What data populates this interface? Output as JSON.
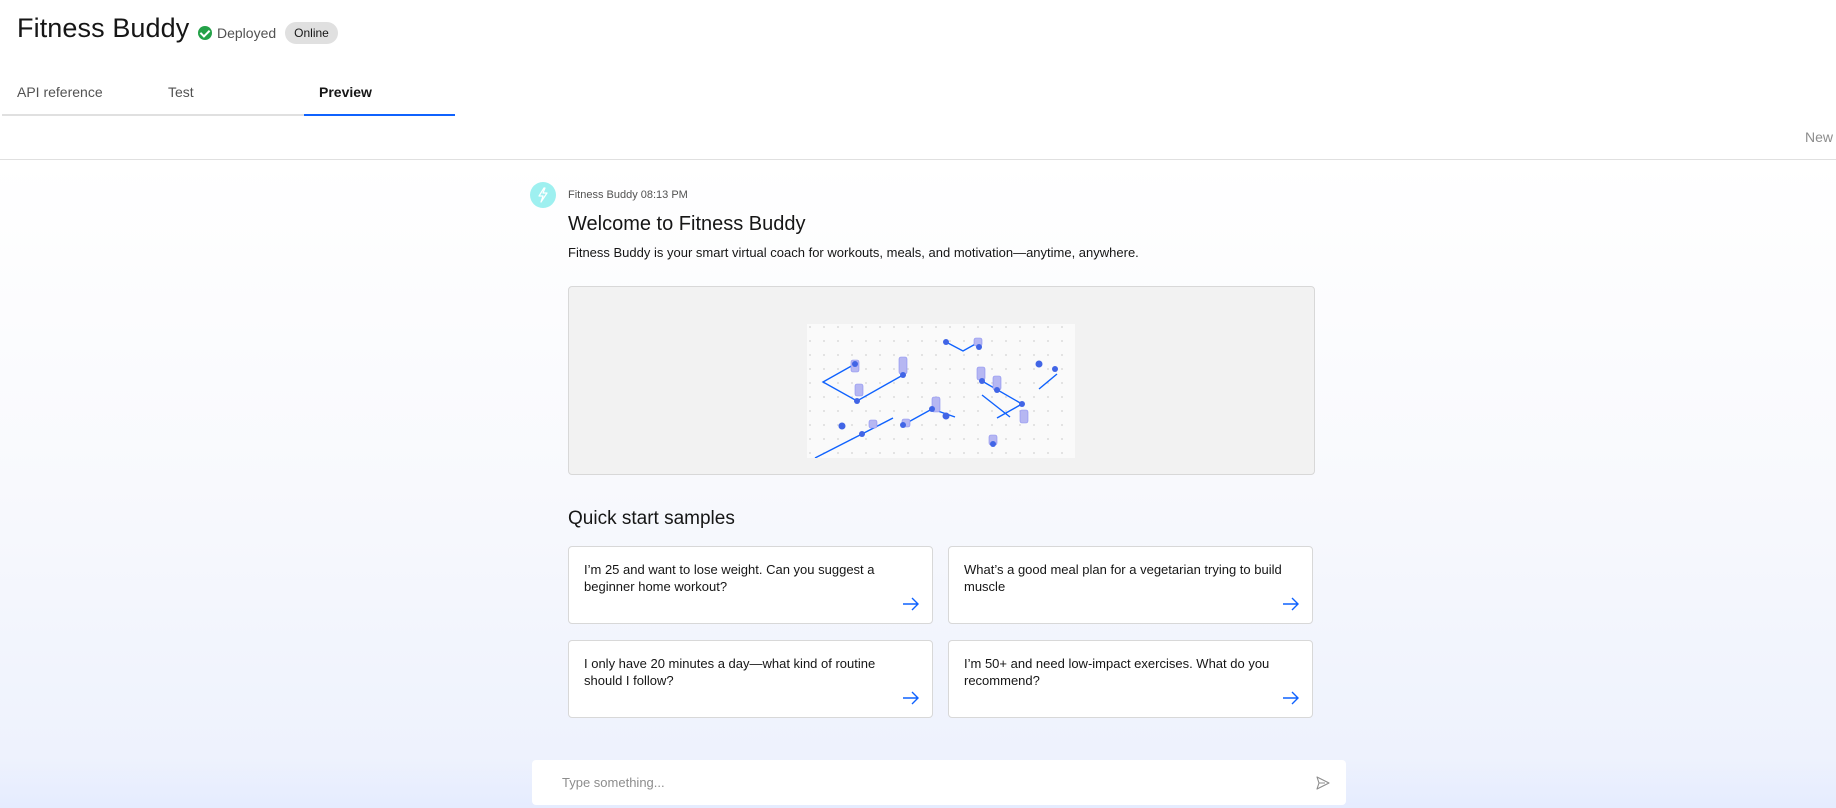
{
  "app": {
    "title": "Fitness Buddy",
    "status": "Deployed",
    "badge": "Online"
  },
  "tabs": [
    {
      "label": "API reference",
      "active": false
    },
    {
      "label": "Test",
      "active": false
    },
    {
      "label": "Preview",
      "active": true
    }
  ],
  "header": {
    "new_label": "New"
  },
  "message": {
    "sender": "Fitness Buddy",
    "time": "08:13 PM",
    "sender_time": "Fitness Buddy 08:13 PM",
    "welcome_title": "Welcome to Fitness Buddy",
    "description": "Fitness Buddy is your smart virtual coach for workouts, meals, and motivation—anytime, anywhere."
  },
  "quick_start": {
    "title": "Quick start samples",
    "samples": [
      "I’m 25 and want to lose weight. Can you suggest a beginner home workout?",
      "What’s a good meal plan for a vegetarian trying to build muscle",
      "I only have 20 minutes a day—what kind of routine should I follow?",
      "I’m 50+ and need low-impact exercises. What do you recommend?"
    ]
  },
  "input": {
    "placeholder": "Type something...",
    "value": ""
  },
  "icons": {
    "status": "check-circle-icon",
    "avatar": "lightning-icon",
    "sample_arrow": "arrow-right-icon",
    "send": "send-icon"
  },
  "colors": {
    "accent": "#0f62fe",
    "success": "#24a148",
    "avatar_bg": "#9ef0f0"
  }
}
